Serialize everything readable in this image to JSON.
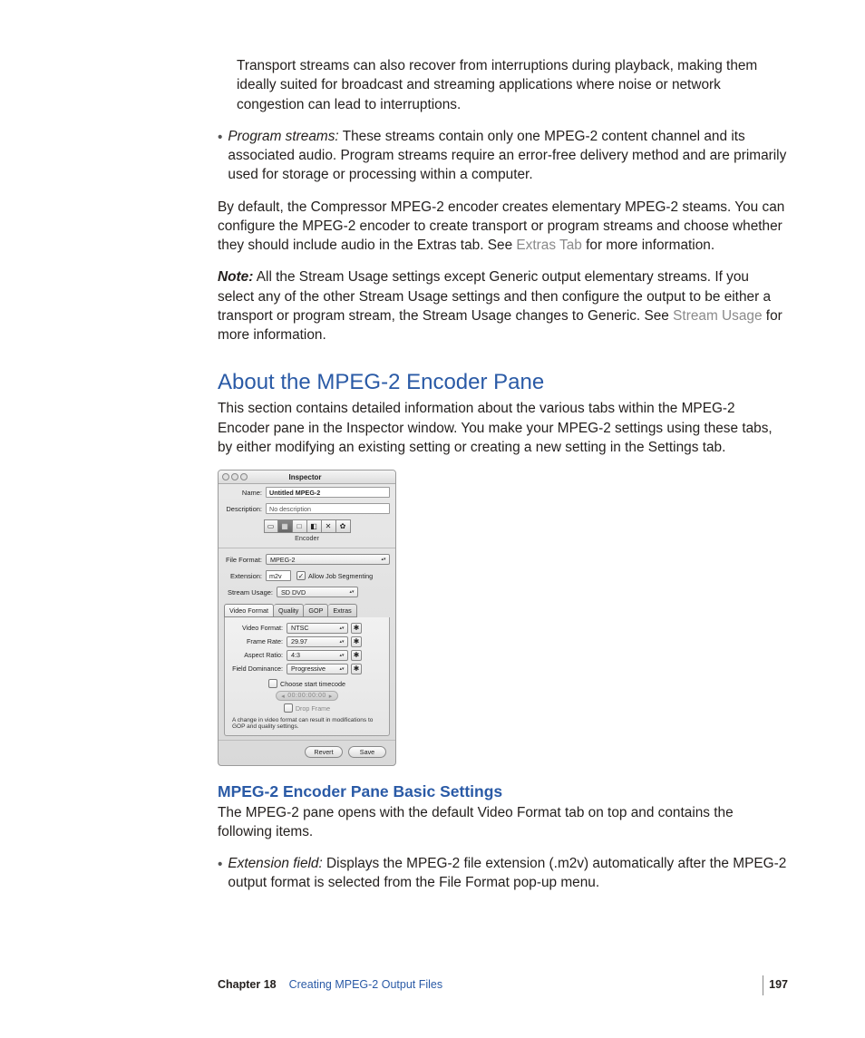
{
  "body": {
    "para1": "Transport streams can also recover from interruptions during playback, making them ideally suited for broadcast and streaming applications where noise or network congestion can lead to interruptions.",
    "bullet_program_label": "Program streams:",
    "bullet_program_text": "  These streams contain only one MPEG-2 content channel and its associated audio. Program streams require an error-free delivery method and are primarily used for storage or processing within a computer.",
    "para2a": "By default, the Compressor MPEG-2 encoder creates elementary MPEG-2 steams. You can configure the MPEG-2 encoder to create transport or program streams and choose whether they should include audio in the Extras tab. See ",
    "para2_link": "Extras Tab",
    "para2b": " for more information.",
    "note_label": "Note:",
    "note_a": "  All the Stream Usage settings except Generic output elementary streams. If you select any of the other Stream Usage settings and then configure the output to be either a transport or program stream, the Stream Usage changes to Generic. See ",
    "note_link": "Stream Usage",
    "note_b": " for more information."
  },
  "section": {
    "title": "About the MPEG-2 Encoder Pane",
    "intro": "This section contains detailed information about the various tabs within the MPEG-2 Encoder pane in the Inspector window. You make your MPEG-2 settings using these tabs, by either modifying an existing setting or creating a new setting in the Settings tab."
  },
  "inspector": {
    "title": "Inspector",
    "name_label": "Name:",
    "name_value": "Untitled MPEG-2",
    "desc_label": "Description:",
    "desc_value": "No description",
    "encoder_label": "Encoder",
    "file_format_label": "File Format:",
    "file_format_value": "MPEG-2",
    "extension_label": "Extension:",
    "extension_value": "m2v",
    "allow_seg_label": "Allow Job Segmenting",
    "stream_usage_label": "Stream Usage:",
    "stream_usage_value": "SD DVD",
    "tabs": [
      "Video Format",
      "Quality",
      "GOP",
      "Extras"
    ],
    "video_format_label": "Video Format:",
    "video_format_value": "NTSC",
    "frame_rate_label": "Frame Rate:",
    "frame_rate_value": "29.97",
    "aspect_ratio_label": "Aspect Ratio:",
    "aspect_ratio_value": "4:3",
    "field_dom_label": "Field Dominance:",
    "field_dom_value": "Progressive",
    "choose_start_label": "Choose start timecode",
    "timecode": "00:00:00:00",
    "drop_frame_label": "Drop Frame",
    "panel_note": "A change in video format can result in modifications to GOP and quality settings.",
    "revert": "Revert",
    "save": "Save"
  },
  "subsection": {
    "title": "MPEG-2 Encoder Pane Basic Settings",
    "intro": "The MPEG-2 pane opens with the default Video Format tab on top and contains the following items.",
    "bullet_ext_label": "Extension field:",
    "bullet_ext_text": "  Displays the MPEG-2 file extension (.m2v) automatically after the MPEG-2 output format is selected from the File Format pop-up menu."
  },
  "footer": {
    "chapter_label": "Chapter 18",
    "chapter_title": "Creating MPEG-2 Output Files",
    "page": "197"
  }
}
